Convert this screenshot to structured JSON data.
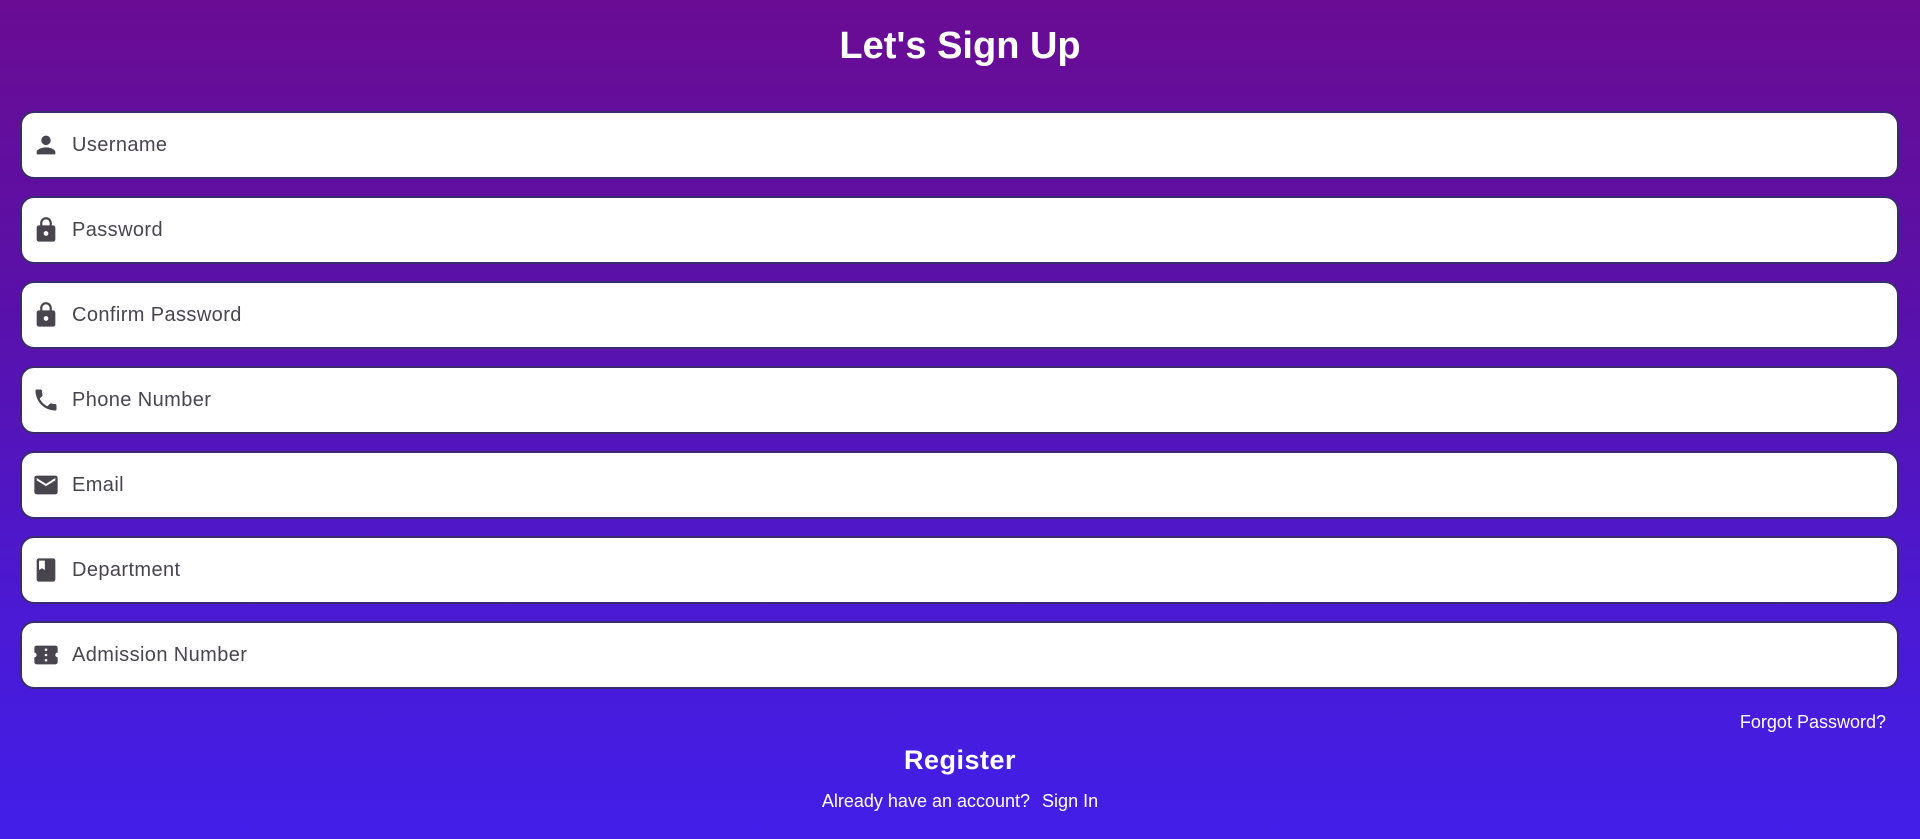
{
  "page": {
    "title": "Let's Sign Up"
  },
  "form": {
    "fields": [
      {
        "icon": "person-icon",
        "placeholder": "Username",
        "value": ""
      },
      {
        "icon": "lock-icon",
        "placeholder": "Password",
        "value": ""
      },
      {
        "icon": "lock-icon",
        "placeholder": "Confirm Password",
        "value": ""
      },
      {
        "icon": "phone-icon",
        "placeholder": "Phone Number",
        "value": ""
      },
      {
        "icon": "email-icon",
        "placeholder": "Email",
        "value": ""
      },
      {
        "icon": "book-icon",
        "placeholder": "Department",
        "value": ""
      },
      {
        "icon": "ticket-icon",
        "placeholder": "Admission Number",
        "value": ""
      }
    ],
    "forgot_label": "Forgot Password?",
    "register_label": "Register",
    "signin_prompt": "Already have an account?",
    "signin_label": "Sign In"
  },
  "colors": {
    "gradient_top": "#6a0c94",
    "gradient_bottom": "#421ee8",
    "field_background": "#ffffff",
    "field_border": "#3a2a6e",
    "icon_color": "#49454f",
    "text_light": "#ffffff"
  }
}
